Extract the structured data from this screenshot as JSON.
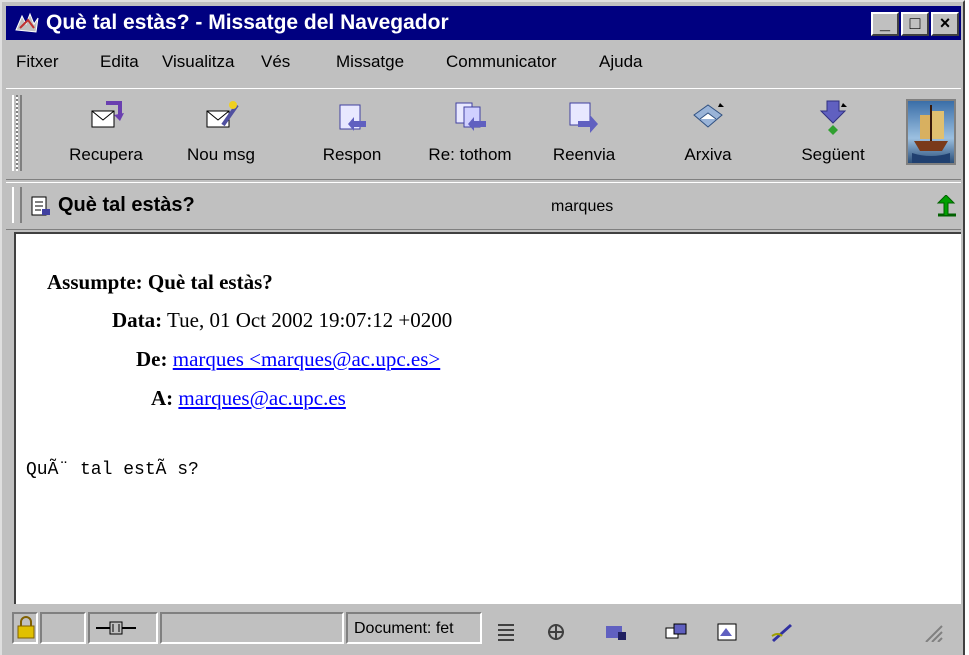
{
  "window": {
    "title": "Què tal estàs? - Missatge del Navegador",
    "controls": {
      "minimize": "_",
      "maximize": "□",
      "close": "×"
    }
  },
  "menu": [
    "Fitxer",
    "Edita",
    "Visualitza",
    "Vés",
    "Missatge",
    "Communicator",
    "Ajuda"
  ],
  "toolbar": {
    "buttons": [
      {
        "label": "Recupera",
        "icon": "get-mail-icon"
      },
      {
        "label": "Nou msg",
        "icon": "new-message-icon"
      },
      {
        "label": "Respon",
        "icon": "reply-icon"
      },
      {
        "label": "Re: tothom",
        "icon": "reply-all-icon"
      },
      {
        "label": "Reenvia",
        "icon": "forward-icon"
      },
      {
        "label": "Arxiva",
        "icon": "file-icon"
      },
      {
        "label": "Següent",
        "icon": "next-icon"
      }
    ]
  },
  "message_header_bar": {
    "subject": "Què tal estàs?",
    "sender": "marques"
  },
  "message": {
    "subject_label": "Assumpte:",
    "subject": "Què tal estàs?",
    "date_label": "Data:",
    "date": "Tue, 01 Oct 2002 19:07:12 +0200",
    "from_label": "De:",
    "from": "marques <marques@ac.upc.es>",
    "to_label": "A:",
    "to": "marques@ac.upc.es",
    "body": "QuÃ¨ tal estÃ s?"
  },
  "statusbar": {
    "document_status": "Document: fet"
  }
}
